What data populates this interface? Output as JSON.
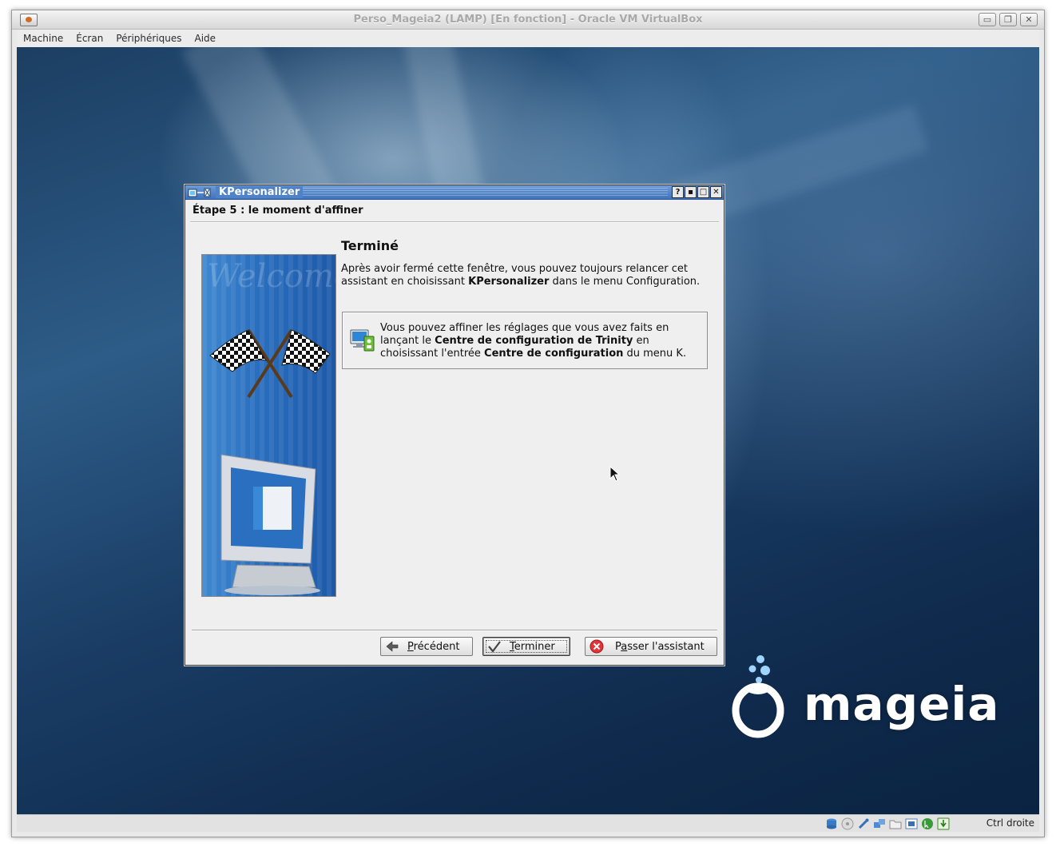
{
  "host": {
    "title": "Perso_Mageia2 (LAMP) [En fonction] - Oracle VM VirtualBox",
    "controls": {
      "minimize": "▭",
      "restore": "❐",
      "close": "✕"
    },
    "menu": [
      {
        "label": "Machine"
      },
      {
        "label": "Écran"
      },
      {
        "label": "Périphériques"
      },
      {
        "label": "Aide"
      }
    ],
    "statusbar": {
      "icons": [
        "hard-disk-icon",
        "optical-drive-icon",
        "usb-icon",
        "network-icon",
        "shared-folders-icon",
        "video-capture-icon",
        "mouse-integration-icon",
        "keyboard-capture-icon"
      ],
      "host_key": "Ctrl droite"
    }
  },
  "desktop": {
    "logo_text": "mageia"
  },
  "dialog": {
    "title": "KPersonalizer",
    "controls": {
      "help": "?",
      "shade": "▪",
      "maximize": "□",
      "close": "✕"
    },
    "step_title": "Étape 5 : le moment d'affiner",
    "side_watermark": "Welcome",
    "heading": "Terminé",
    "paragraph": {
      "before": "Après avoir fermé cette fenêtre, vous pouvez toujours relancer cet assistant en choisissant ",
      "bold": "KPersonalizer",
      "after": " dans le menu Configuration."
    },
    "info": {
      "part1": "Vous pouvez affiner les réglages que vous avez faits en lançant le ",
      "bold1": "Centre de configuration de Trinity",
      "part2": " en choisissant l'entrée ",
      "bold2": "Centre de configuration",
      "part3": " du menu K."
    },
    "buttons": {
      "previous": {
        "accel": "P",
        "rest": "récédent"
      },
      "finish": {
        "accel": "T",
        "rest": "erminer"
      },
      "skip": {
        "pre": "P",
        "accel": "a",
        "rest": "sser l'assistant"
      }
    }
  },
  "colors": {
    "dialog_titlebar": "#4f82c6",
    "desktop_dark": "#0f2a4c",
    "desktop_light": "#2d5c88"
  }
}
